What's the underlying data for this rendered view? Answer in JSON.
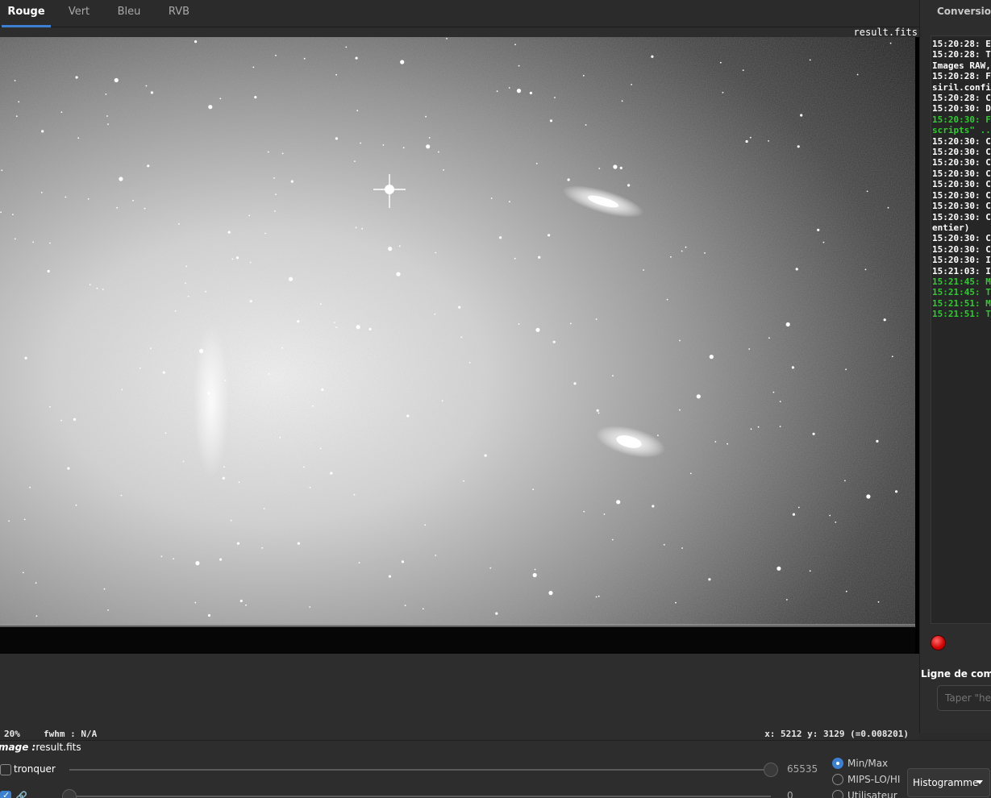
{
  "tabs": [
    {
      "label": "Rouge",
      "active": true
    },
    {
      "label": "Vert",
      "active": false
    },
    {
      "label": "Bleu",
      "active": false
    },
    {
      "label": "RVB",
      "active": false
    }
  ],
  "viewer": {
    "filename": "result.fits"
  },
  "status": {
    "zoom": "20%",
    "fwhm": "fwhm : N/A",
    "coords": "x: 5212 y: 3129 (=0.008201)"
  },
  "right_panel": {
    "tab_label": "Conversion",
    "log": [
      {
        "text": "15:20:28: E",
        "color": "white"
      },
      {
        "text": "15:20:28: T",
        "color": "white"
      },
      {
        "text": "Images RAW,",
        "color": "white"
      },
      {
        "text": "15:20:28: F",
        "color": "white"
      },
      {
        "text": "siril.confi",
        "color": "white"
      },
      {
        "text": "15:20:28: C",
        "color": "white"
      },
      {
        "text": "15:20:30: D",
        "color": "white"
      },
      {
        "text": "15:20:30: F",
        "color": "green"
      },
      {
        "text": "scripts\" ..",
        "color": "green"
      },
      {
        "text": "15:20:30: C",
        "color": "white"
      },
      {
        "text": "15:20:30: C",
        "color": "white"
      },
      {
        "text": "15:20:30: C",
        "color": "white"
      },
      {
        "text": "15:20:30: C",
        "color": "white"
      },
      {
        "text": "15:20:30: C",
        "color": "white"
      },
      {
        "text": "15:20:30: C",
        "color": "white"
      },
      {
        "text": "15:20:30: C",
        "color": "white"
      },
      {
        "text": "15:20:30: C",
        "color": "white"
      },
      {
        "text": "entier)",
        "color": "white"
      },
      {
        "text": "15:20:30: C",
        "color": "white"
      },
      {
        "text": "15:20:30: C",
        "color": "white"
      },
      {
        "text": "15:20:30: I",
        "color": "white"
      },
      {
        "text": "15:21:03: I",
        "color": "white"
      },
      {
        "text": "15:21:45: M",
        "color": "green"
      },
      {
        "text": "15:21:45: T",
        "color": "green"
      },
      {
        "text": "15:21:51: M",
        "color": "green"
      },
      {
        "text": "15:21:51: T",
        "color": "green"
      }
    ],
    "command_title": "Ligne de comm",
    "command_placeholder": "Taper \"help"
  },
  "bottom": {
    "image_label_prefix": "mage :",
    "image_label_value": "result.fits",
    "tronquer_label": "tronquer",
    "tronquer_checked": false,
    "link_checked": true,
    "high_value": "65535",
    "high_level": 1.0,
    "low_value": "0",
    "low_level": 0.0,
    "scale_options": [
      {
        "label": "Min/Max",
        "selected": true
      },
      {
        "label": "MIPS-LO/HI",
        "selected": false
      },
      {
        "label": "Utilisateur",
        "selected": false
      }
    ],
    "histogram_button": "Histogramme"
  },
  "colors": {
    "accent": "#3d7fd1",
    "record": "#e00000",
    "log_green": "#2ecc2e"
  }
}
